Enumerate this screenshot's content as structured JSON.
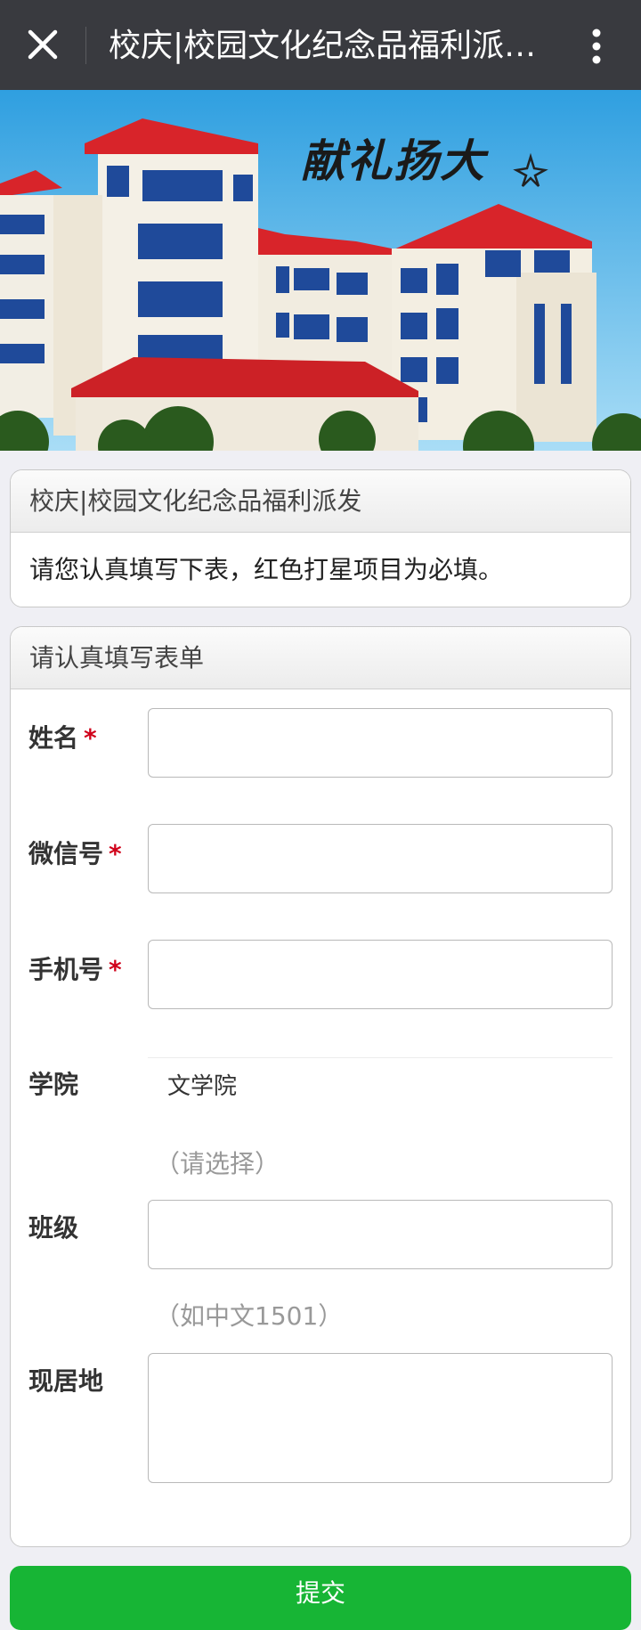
{
  "header": {
    "title": "校庆|校园文化纪念品福利派…"
  },
  "banner": {
    "slogan": "献礼扬大"
  },
  "intro": {
    "title": "校庆|校园文化纪念品福利派发",
    "text": "请您认真填写下表，红色打星项目为必填。"
  },
  "form": {
    "title": "请认真填写表单",
    "required_mark": "*",
    "fields": {
      "name": {
        "label": "姓名",
        "value": ""
      },
      "wechat": {
        "label": "微信号",
        "value": ""
      },
      "phone": {
        "label": "手机号",
        "value": ""
      },
      "college": {
        "label": "学院",
        "value": "文学院",
        "hint": "（请选择）"
      },
      "class": {
        "label": "班级",
        "value": "",
        "hint": "（如中文1501）"
      },
      "address": {
        "label": "现居地",
        "value": ""
      }
    }
  },
  "submit": {
    "label": "提交"
  },
  "colors": {
    "topbar": "#393a3f",
    "required": "#d0021b",
    "submit": "#17b535"
  }
}
